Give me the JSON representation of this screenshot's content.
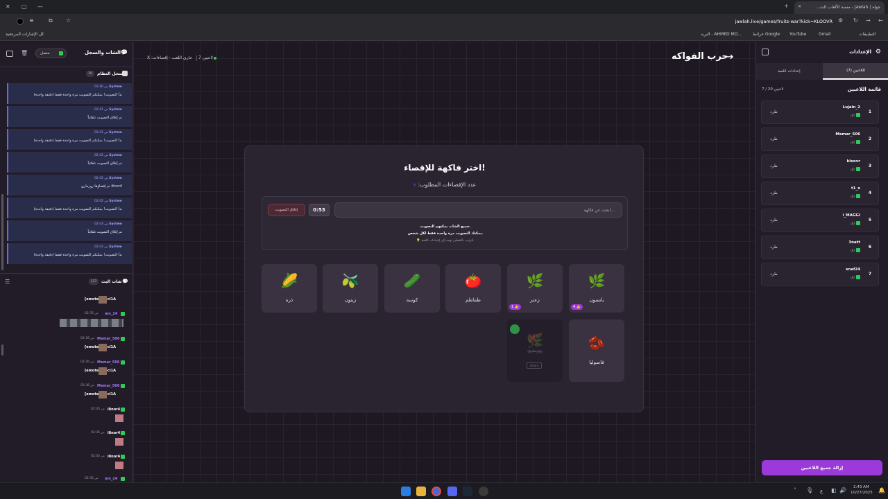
{
  "browser": {
    "tab_title": "جولة | Jawlah - منصة الألعاب الت...",
    "url": "jawlah.live/games/fruits-war?kick=KLOOVR",
    "bookmarks": [
      "التطبيقات",
      "Gmail",
      "YouTube",
      "خرائط Google",
      "البريد - AHMED MO..."
    ],
    "all_bookmarks": "كل الإشارات المرجعية"
  },
  "header": {
    "players_count": "7 لاعبين",
    "game_status": "جاري اللعب - إقصاءات: X",
    "game_title": "حرب الفواكه"
  },
  "left_panel": {
    "title": "الشات والسجل",
    "status": "متصل",
    "system_log_title": "سجل النظام",
    "system_log_count": "16",
    "system_log": [
      {
        "user": "System",
        "time": "02:40 ص",
        "text": "بدأ التصويت! يمكنكم التصويت مرة واحدة فقط (دقيقة واحدة)"
      },
      {
        "user": "System",
        "time": "02:41 ص",
        "text": "تم إغلاق التصويت تلقائياً"
      },
      {
        "user": "System",
        "time": "02:41 ص",
        "text": "بدأ التصويت! يمكنكم التصويت مرة واحدة فقط (دقيقة واحدة)"
      },
      {
        "user": "System",
        "time": "02:42 ص",
        "text": "تم إغلاق التصويت تلقائياً"
      },
      {
        "user": "System",
        "time": "02:42 ص",
        "text": "ilinor4 تم إقصاؤها روزماري"
      },
      {
        "user": "System",
        "time": "02:42 ص",
        "text": "بدأ التصويت! يمكنكم التصويت مرة واحدة فقط (دقيقة واحدة)"
      },
      {
        "user": "System",
        "time": "02:43 ص",
        "text": "تم إغلاق التصويت تلقائياً"
      },
      {
        "user": "System",
        "time": "02:43 ص",
        "text": "بدأ التصويت! يمكنكم التصويت مرة واحدة فقط (دقيقة واحدة)"
      }
    ],
    "live_chat_title": "شات البث",
    "live_chat_count": "127",
    "chat": [
      {
        "user": "",
        "time": "",
        "text": "[emote life-cl1A"
      },
      {
        "user": "mn_24",
        "time": "02:35 ص",
        "text": ""
      },
      {
        "user": "Memar_506",
        "time": "02:36 ص",
        "text": "[emote life-cl1A"
      },
      {
        "user": "Memar_506",
        "time": "02:36 ص",
        "text": "[emote life-cl1A"
      },
      {
        "user": "Memar_506",
        "time": "02:36 ص",
        "text": "[emote life-cl1A"
      },
      {
        "user": "ilinor4",
        "time": "02:35 ص",
        "text": ""
      },
      {
        "user": "ilinor4",
        "time": "02:35 ص",
        "text": ""
      },
      {
        "user": "ilinor4",
        "time": "02:35 ص",
        "text": ""
      },
      {
        "user": "mn_24",
        "time": "02:35 ص",
        "text": ""
      }
    ]
  },
  "modal": {
    "title": "اختر فاكهة للإقصاء!",
    "subtitle": "عدد الإقصاءات المطلوب:",
    "subtitle_value": "X",
    "search_placeholder": "ابحث عن فاكهة...",
    "timer": "0:53",
    "close_vote": "إغلاق التصويت",
    "info_line1": "جميع الشات يمكنهم التصويت.",
    "info_line2": "يمكنك التصويت مرة واحدة فقط لكل شخص.",
    "info_line3": "💡 لترتيب بالتقطير توجه إلى إعدادات اللعبة.",
    "fruits": [
      {
        "name": "يانسون",
        "icon": "🌿",
        "votes": "4"
      },
      {
        "name": "زعتر",
        "icon": "🌿",
        "votes": "1"
      },
      {
        "name": "طماطم",
        "icon": "🍅",
        "votes": ""
      },
      {
        "name": "كوسة",
        "icon": "🥒",
        "votes": ""
      },
      {
        "name": "زيتون",
        "icon": "🫒",
        "votes": ""
      },
      {
        "name": "ذرة",
        "icon": "🌽",
        "votes": ""
      },
      {
        "name": "فاصوليا",
        "icon": "🫘",
        "votes": ""
      },
      {
        "name": "روزماري",
        "icon": "🌿",
        "votes": "",
        "eliminated": true,
        "eliminated_by": "ilinor4"
      }
    ]
  },
  "right_panel": {
    "title": "الإعدادات",
    "tab_players": "اللاعبين (7)",
    "tab_settings": "إعدادات اللعبة",
    "players_list_title": "قائمة اللاعبين",
    "players_count": "7 / 20 لاعبين",
    "kick_label": "طرد",
    "platform": "كيك",
    "players": [
      {
        "num": "1",
        "name": "Lujain_2"
      },
      {
        "num": "2",
        "name": "Memar_506"
      },
      {
        "num": "3",
        "name": "kloovr"
      },
      {
        "num": "4",
        "name": "t1_o"
      },
      {
        "num": "5",
        "name": "i_MAGGI"
      },
      {
        "num": "6",
        "name": "3natt"
      },
      {
        "num": "7",
        "name": "snaf24"
      }
    ],
    "remove_all": "إزالة جميع اللاعبين"
  },
  "taskbar": {
    "time": "2:43 AM",
    "date": "10/27/2025",
    "lang": "ع"
  },
  "colors": {
    "accent": "#9b3ad9",
    "kick_green": "#2ecc55",
    "log_blue": "#5b6ee8"
  }
}
